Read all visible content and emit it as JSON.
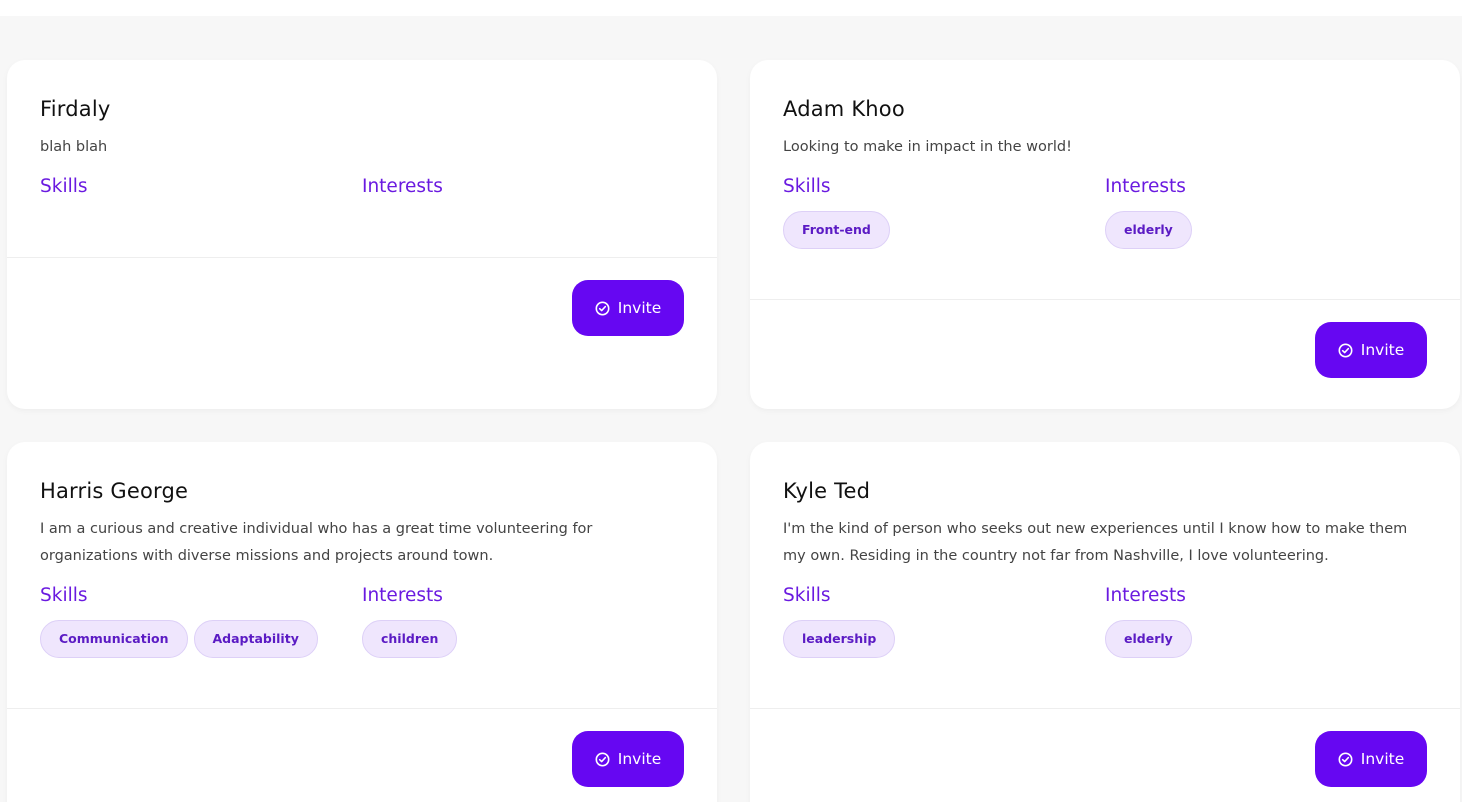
{
  "accent_color": "#6607f2",
  "volunteers": [
    {
      "name": "Firdaly",
      "bio": "blah blah",
      "skills_label": "Skills",
      "interests_label": "Interests",
      "skills": [],
      "interests": [],
      "invite_label": "Invite",
      "invite_icon": "check-circle-icon"
    },
    {
      "name": "Adam Khoo",
      "bio": "Looking to make in impact in the world!",
      "skills_label": "Skills",
      "interests_label": "Interests",
      "skills": [
        "Front-end"
      ],
      "interests": [
        "elderly"
      ],
      "invite_label": "Invite",
      "invite_icon": "check-circle-icon"
    },
    {
      "name": "Harris George",
      "bio": "I am a curious and creative individual who has a great time volunteering for organizations with diverse missions and projects around town.",
      "skills_label": "Skills",
      "interests_label": "Interests",
      "skills": [
        "Communication",
        "Adaptability"
      ],
      "interests": [
        "children"
      ],
      "invite_label": "Invite",
      "invite_icon": "check-circle-icon"
    },
    {
      "name": "Kyle Ted",
      "bio": "I'm the kind of person who seeks out new experiences until I know how to make them my own. Residing in the country not far from Nashville, I love volunteering.",
      "skills_label": "Skills",
      "interests_label": "Interests",
      "skills": [
        "leadership"
      ],
      "interests": [
        "elderly"
      ],
      "invite_label": "Invite",
      "invite_icon": "check-circle-icon"
    }
  ]
}
